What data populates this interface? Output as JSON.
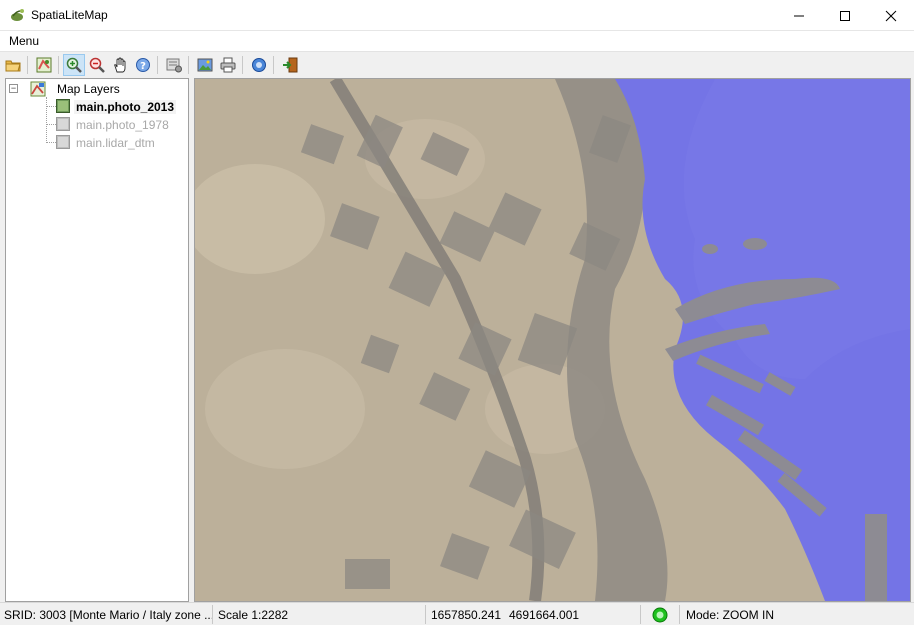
{
  "window": {
    "title": "SpatiaLiteMap",
    "minimize_icon": "minimize-icon",
    "maximize_icon": "maximize-icon",
    "close_icon": "close-icon"
  },
  "menubar": {
    "items": [
      "Menu"
    ]
  },
  "toolbar": {
    "buttons": [
      {
        "name": "open-folder-icon"
      },
      {
        "name": "layers-icon"
      },
      {
        "name": "zoom-in-icon",
        "active": true
      },
      {
        "name": "zoom-out-icon"
      },
      {
        "name": "pan-hand-icon"
      },
      {
        "name": "identify-icon"
      },
      {
        "name": "settings-icon"
      },
      {
        "name": "export-image-icon"
      },
      {
        "name": "print-icon"
      },
      {
        "name": "info-icon"
      },
      {
        "name": "exit-icon"
      }
    ]
  },
  "layers": {
    "root_label": "Map Layers",
    "items": [
      {
        "label": "main.photo_2013",
        "state": "selected"
      },
      {
        "label": "main.photo_1978",
        "state": "disabled"
      },
      {
        "label": "main.lidar_dtm",
        "state": "disabled"
      }
    ]
  },
  "statusbar": {
    "srid": "SRID: 3003 [Monte Mario / Italy zone ...",
    "scale": "Scale 1:2282",
    "x": "1657850.241",
    "y": "4691664.001",
    "mode": "Mode: ZOOM IN",
    "status_color": "#1ec11e"
  },
  "colors": {
    "map_land": "#bcb09a",
    "map_sea": "#7474e6",
    "map_shadow": "#8a8a86",
    "selection": "#cce4f7"
  }
}
